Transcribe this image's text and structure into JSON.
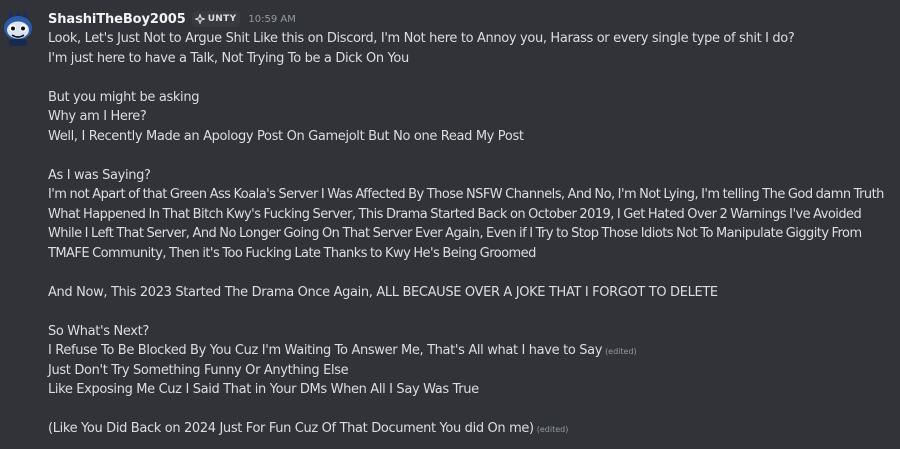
{
  "message": {
    "username": "ShashiTheBoy2005",
    "tag": "UNTY",
    "timestamp": "10:59 AM",
    "edited_label": "(edited)",
    "lines": [
      "Look, Let's Just Not to Argue Shit Like this on Discord, I'm Not here to Annoy you, Harass or every single type of shit I do?",
      "I'm just here to have a Talk, Not Trying To be a Dick On You",
      "But you might be asking",
      "Why am I Here?",
      "Well, I Recently Made an Apology Post On Gamejolt But No one Read My Post",
      "As I was Saying?",
      "I'm not Apart of that Green Ass Koala's Server I Was Affected By Those NSFW Channels, And No, I'm Not Lying, I'm telling The God damn Truth What Happened In That Bitch Kwy's Fucking Server, This Drama Started Back on October 2019, I Get Hated Over 2 Warnings I've Avoided While I Left That Server, And No Longer Going On That Server Ever Again, Even if I Try to Stop Those Idiots Not To Manipulate Giggity From TMAFE Community, Then it's Too Fucking Late Thanks to Kwy He's Being Groomed",
      "And Now, This 2023 Started The Drama Once Again, ALL BECAUSE OVER A JOKE THAT I FORGOT TO DELETE",
      "So What's Next?",
      "I Refuse To Be Blocked By You Cuz I'm Waiting To Answer Me, That's All what I have to Say",
      "Just Don't Try Something Funny Or Anything Else",
      "Like Exposing Me Cuz I Said That in Your DMs When All I Say Was True",
      "(Like You Did Back on 2024 Just For Fun Cuz Of That Document You did On me)"
    ]
  },
  "icons": {
    "avatar": "blue-cartoon-avatar-icon",
    "tag": "guild-tag-sparkle-icon"
  },
  "colors": {
    "background": "#313338",
    "text": "#dbdee1",
    "username": "#f2f3f5",
    "muted": "#949ba4",
    "tag_bg": "#393a41"
  }
}
